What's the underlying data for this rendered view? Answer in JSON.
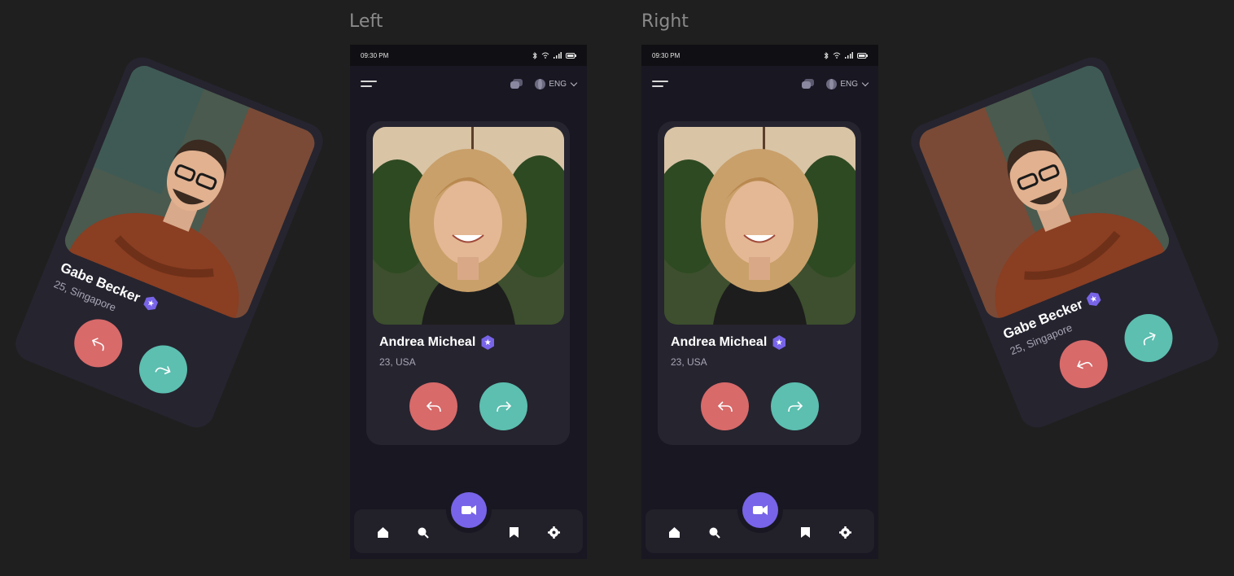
{
  "labels": {
    "left": "Left",
    "right": "Right"
  },
  "status": {
    "time": "09:30 PM"
  },
  "topbar": {
    "language": "ENG"
  },
  "profile": {
    "name": "Andrea Micheal",
    "subtitle": "23, USA"
  },
  "side_profile": {
    "name": "Gabe Becker",
    "subtitle": "25, Singapore"
  },
  "colors": {
    "accent": "#7764e8",
    "reject": "#d86a6a",
    "accept": "#5cbfb0",
    "background": "#1f1f1f",
    "card": "#26242f"
  },
  "icons": [
    "menu-icon",
    "chat-icon",
    "globe-icon",
    "chevron-down-icon",
    "verified-badge-icon",
    "undo-icon",
    "redo-icon",
    "home-icon",
    "search-icon",
    "video-icon",
    "bookmark-icon",
    "settings-icon"
  ]
}
